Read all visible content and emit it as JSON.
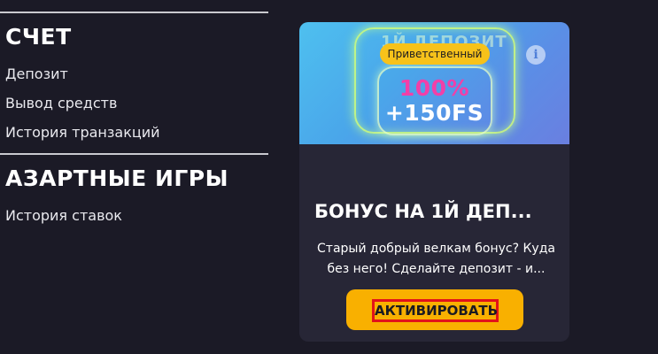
{
  "menu": {
    "account": {
      "title": "СЧЕТ",
      "items": [
        "Депозит",
        "Вывод средств",
        "История транзакций"
      ]
    },
    "gambling": {
      "title": "АЗАРТНЫЕ ИГРЫ",
      "items": [
        "История ставок"
      ]
    }
  },
  "bonus_card": {
    "badge": "Приветственный",
    "banner_ghost": "1Й ДЕПОЗИТ",
    "promo_percent": "100%",
    "promo_spins": "+150FS",
    "info_icon": "info-icon",
    "title": "БОНУС НА 1Й ДЕП...",
    "description": "Старый добрый велкам бонус? Куда без него! Сделайте депозит - и...",
    "button_label": "АКТИВИРОВАТЬ"
  },
  "colors": {
    "background": "#1b1a26",
    "card": "#272636",
    "accent_yellow": "#f9b000",
    "highlight_red": "#e2121a",
    "promo_pink": "#f23fa8"
  }
}
